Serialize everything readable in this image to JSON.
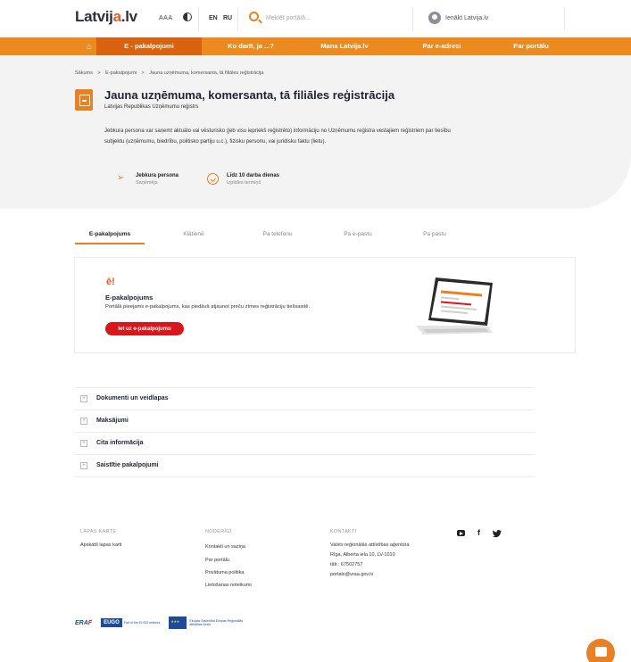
{
  "header": {
    "logo_prefix": "Latvij",
    "logo_accent": "a",
    "logo_suffix": ".lv",
    "font_size_label": "AAA",
    "lang_en": "EN",
    "lang_ru": "RU",
    "search_placeholder": "Meklēt portālā...",
    "login_label": "Ienākt Latvija.lv"
  },
  "nav": {
    "items": [
      {
        "label": "E - pakalpojumi"
      },
      {
        "label": "Ko darīt, ja ...?"
      },
      {
        "label": "Mana Latvija.lv"
      },
      {
        "label": "Par e-adresi"
      },
      {
        "label": "Par portālu"
      }
    ]
  },
  "breadcrumb": {
    "items": [
      "Sākums",
      "E-pakalpojumi",
      "Jauna uzņēmuma, komersanta, tā filiāles reģistrācija"
    ],
    "separator": ">"
  },
  "service": {
    "title": "Jauna uzņēmuma, komersanta, tā filiāles reģistrācija",
    "provider": "Latvijas Republikas Uzņēmumu reģistrs",
    "description": "Jebkura persona var saņemt aktuālo vai vēsturisko (jeb visu iepriekš reģistrēto) informāciju no Uzņēmumu reģistra vestajiem reģistriem par tiesību subjektu (uzņēmumu, biedrību, politisko partiju u.c.), fizisku personu, vai juridisku faktu (lietu).",
    "recipient_main": "Jebkura persona",
    "recipient_sub": "Saņēmējs",
    "deadline_main": "Līdz 10 darba dienas",
    "deadline_sub": "Izpildes termiņš"
  },
  "tabs": [
    {
      "label": "E-pakalpojums"
    },
    {
      "label": "Klātienē"
    },
    {
      "label": "Pa telefonu"
    },
    {
      "label": "Pa e-pastu"
    },
    {
      "label": "Pa pastu"
    }
  ],
  "eservice_card": {
    "icon_text": "ē!",
    "title": "E-pakalpojums",
    "text": "Portālā pieejams e-pakalpojums, kas piedāvā atjaunot preču zīmes reģistrāciju tiešsaistē.",
    "button_label": "Iet uz e-pakalpojumu"
  },
  "accordion": [
    {
      "label": "Dokumenti un veidlapas"
    },
    {
      "label": "Maksājumi"
    },
    {
      "label": "Cita informācija"
    },
    {
      "label": "Saistītie pakalpojumi"
    }
  ],
  "footer": {
    "col1_head": "LAPAS KARTE",
    "col1_links": [
      "Apskatīt lapas karti"
    ],
    "col2_head": "NODERĪGI",
    "col2_links": [
      "Kontakti un saziņa",
      "Par portālu",
      "Privātuma politika",
      "Lietošanas noteikumi"
    ],
    "col3_head": "KONTAKTI",
    "col3_lines": [
      "Valsts reģionālās attīstības aģentūra",
      "Rīga, Alberta iela 10, LV-1010",
      "tālr.: 67502757",
      "portals@vraa.gov.lv"
    ],
    "social": {
      "f": "f"
    }
  },
  "partner_logos": {
    "eraf_blue": "ERA",
    "eraf_red": "F",
    "eugo_box": "EUGO",
    "eugo_text": "Part of the EUGO network",
    "eu_text": "Eiropas Savienība Eiropas Reģionālās attīstības fonds"
  },
  "colors": {
    "brand_orange": "#eb8b1f",
    "nav_active": "#d9620f",
    "cta_red": "#d8161b"
  }
}
